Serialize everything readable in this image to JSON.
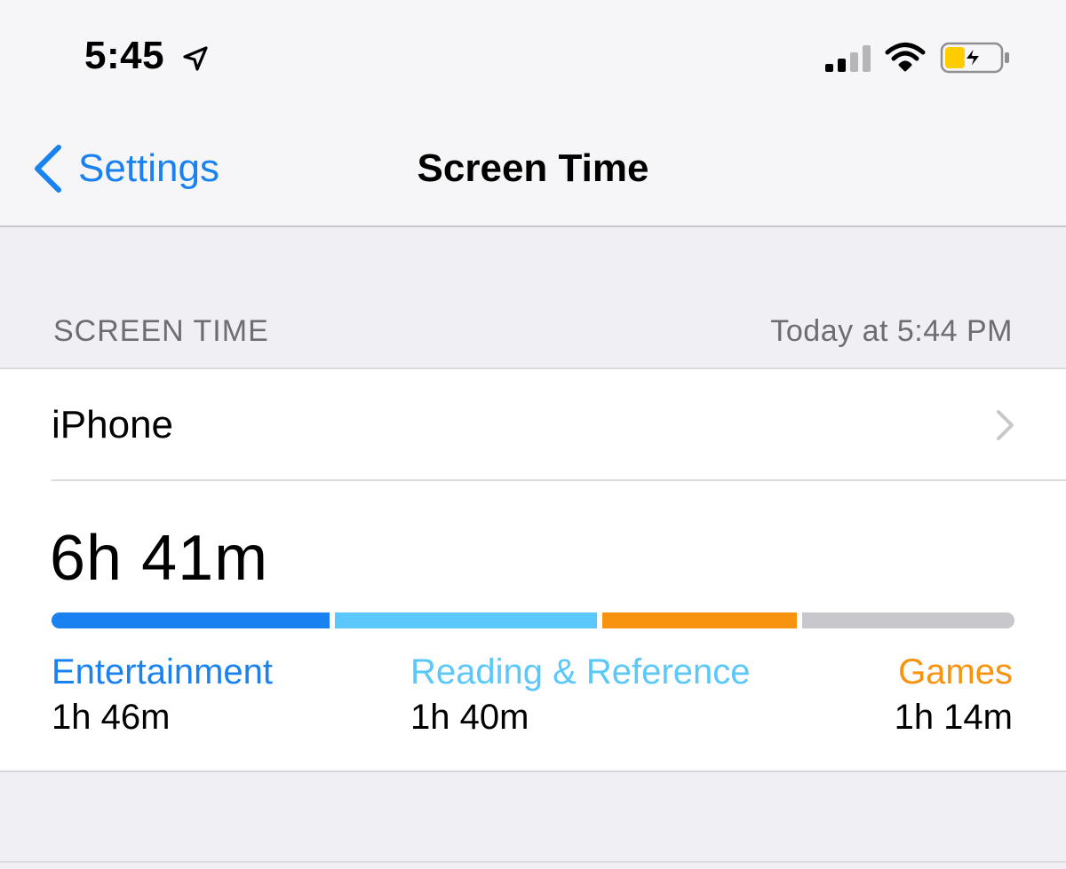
{
  "status_bar": {
    "time": "5:45",
    "location_icon": "location-arrow-icon",
    "signal_icon": "cellular-signal-icon",
    "wifi_icon": "wifi-icon",
    "battery_icon": "battery-charging-icon",
    "signal_bars_active": 2,
    "signal_bars_total": 4
  },
  "nav": {
    "back_label": "Settings",
    "title": "Screen Time"
  },
  "section": {
    "title": "SCREEN TIME",
    "updated": "Today at 5:44 PM"
  },
  "device": {
    "label": "iPhone"
  },
  "usage": {
    "total": "6h 41m",
    "categories": [
      {
        "name": "Entertainment",
        "time": "1h 46m",
        "color": "#1a82f0",
        "minutes": 106
      },
      {
        "name": "Reading & Reference",
        "time": "1h 40m",
        "color": "#5ac8fa",
        "minutes": 100
      },
      {
        "name": "Games",
        "time": "1h 14m",
        "color": "#f7930f",
        "minutes": 74
      }
    ],
    "other_minutes": 81,
    "other_color": "#c7c7cc"
  },
  "colors": {
    "accent": "#1a82f0",
    "background": "#efeff4",
    "battery_fill": "#ffcc00"
  }
}
